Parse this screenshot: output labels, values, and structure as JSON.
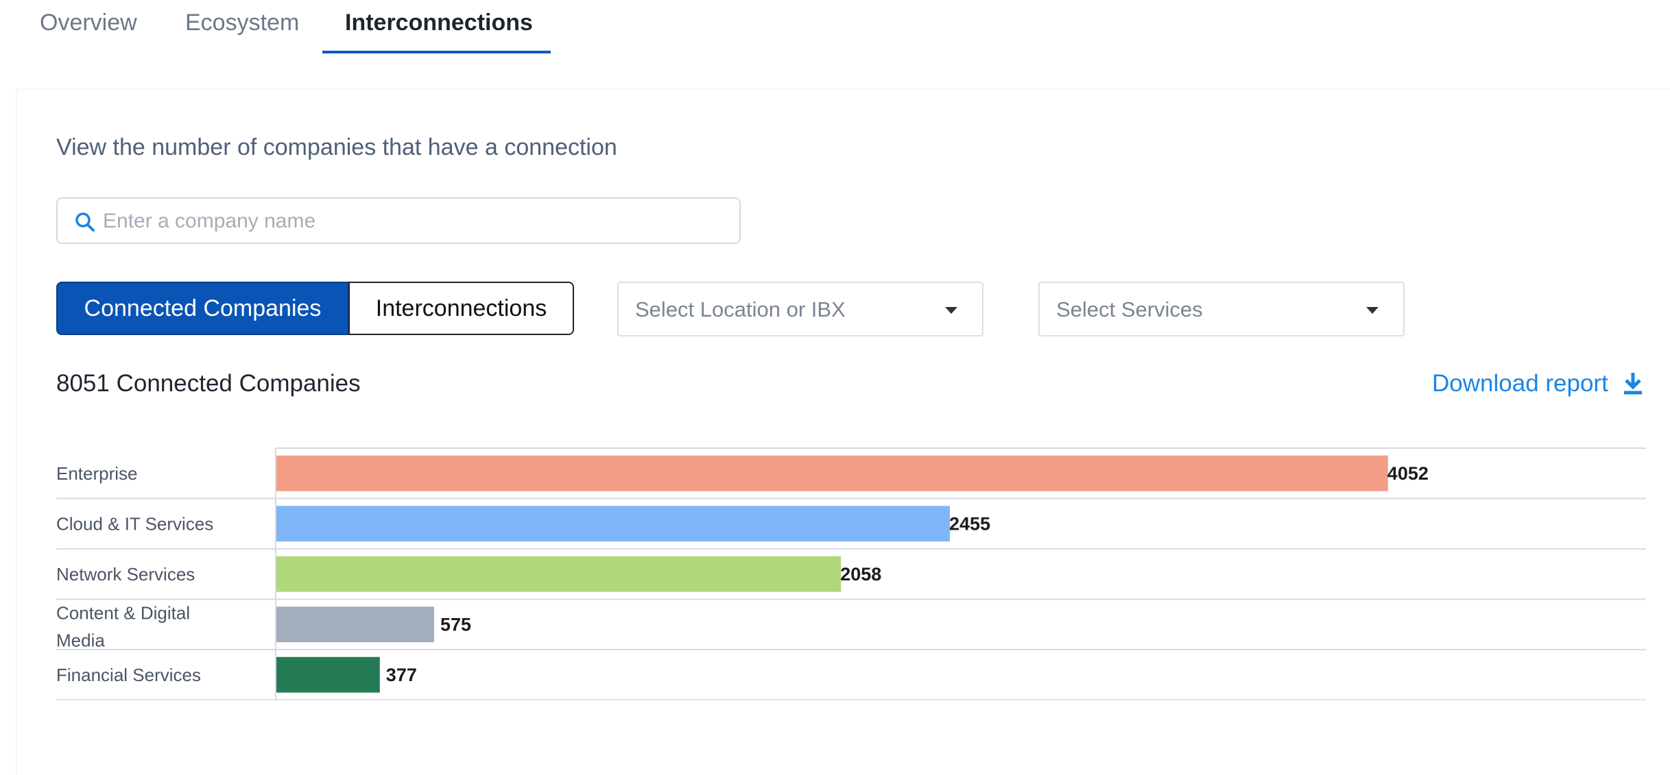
{
  "tabs": [
    {
      "label": "Overview",
      "active": false
    },
    {
      "label": "Ecosystem",
      "active": false
    },
    {
      "label": "Interconnections",
      "active": true
    }
  ],
  "main": {
    "subtitle": "View the number of companies that have a connection",
    "search": {
      "placeholder": "Enter a company name",
      "value": "",
      "icon": "search-icon"
    },
    "toggle": {
      "selected": "Connected Companies",
      "options": [
        "Connected Companies",
        "Interconnections"
      ]
    },
    "location_select": {
      "placeholder": "Select Location or IBX",
      "icon": "caret-down-icon"
    },
    "services_select": {
      "placeholder": "Select Services",
      "icon": "caret-down-icon"
    },
    "count_label": "8051 Connected Companies",
    "download": {
      "label": "Download report",
      "icon": "download-icon"
    }
  },
  "colors": {
    "accent": "#0a54b5",
    "link": "#1a85e6"
  },
  "chart_data": {
    "type": "bar",
    "orientation": "horizontal",
    "categories": [
      "Enterprise",
      "Cloud & IT Services",
      "Network Services",
      "Content & Digital Media",
      "Financial Services"
    ],
    "values": [
      4052,
      2455,
      2058,
      575,
      377
    ],
    "colors": [
      "#f39d87",
      "#80b6f7",
      "#b0d779",
      "#a3aebd",
      "#247a55"
    ],
    "xlim": [
      0,
      5000
    ],
    "grid": false,
    "legend": "none"
  }
}
